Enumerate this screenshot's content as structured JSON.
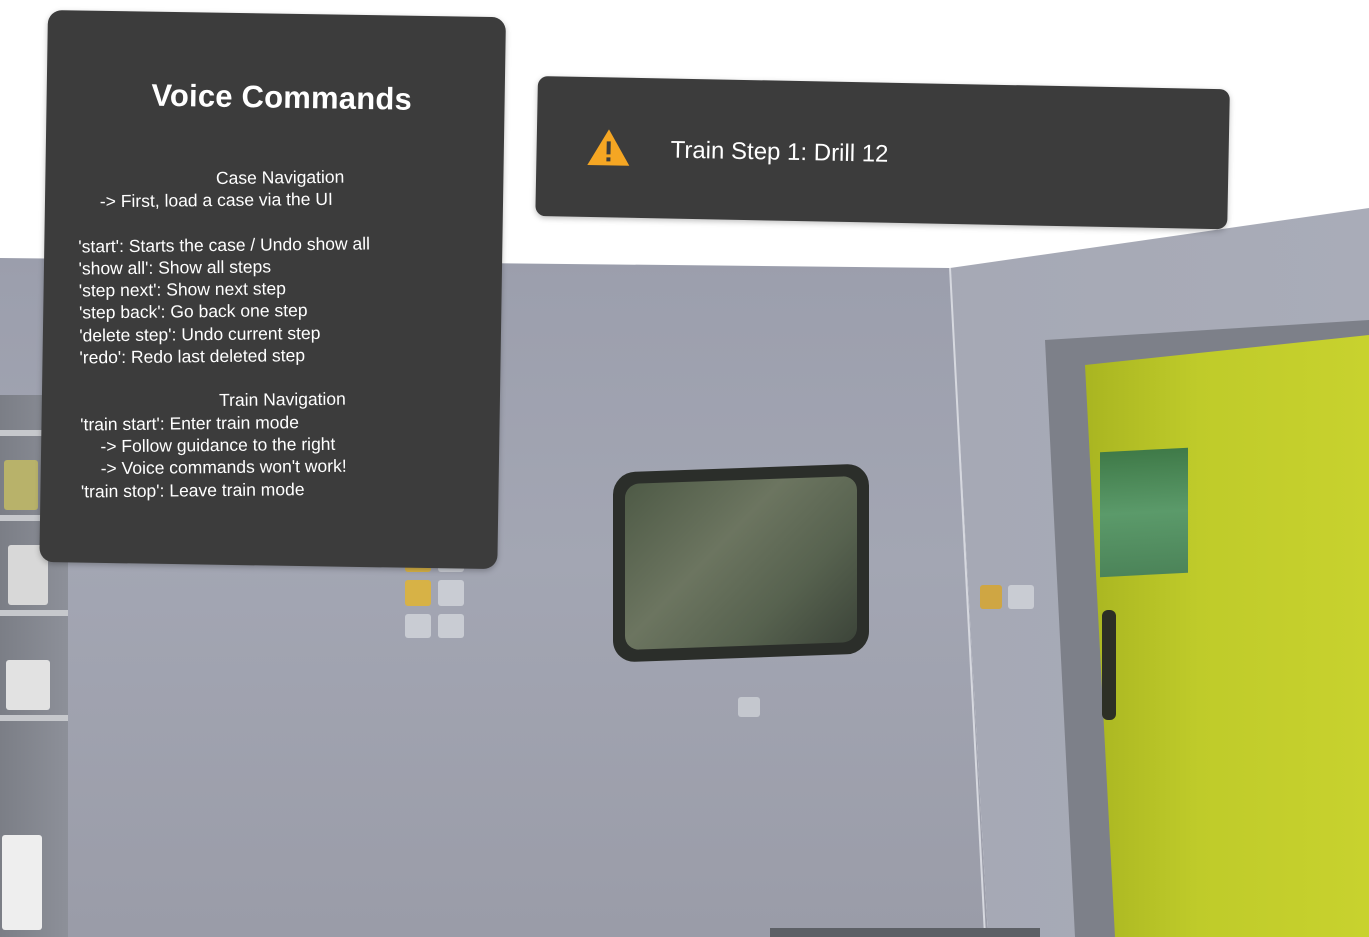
{
  "voice_commands": {
    "title": "Voice Commands",
    "case_section": {
      "heading": "Case Navigation",
      "hint": "-> First, load a case via the UI",
      "commands": [
        "'start': Starts the case / Undo show all",
        "'show all': Show all steps",
        "'step next': Show next step",
        "'step back': Go back one step",
        "'delete step': Undo current step",
        "'redo': Redo last deleted step"
      ]
    },
    "train_section": {
      "heading": "Train Navigation",
      "start_command": "'train start': Enter train mode",
      "notes": [
        "-> Follow guidance to the right",
        "-> Voice commands won't work!"
      ],
      "stop_command": "'train stop': Leave train mode"
    }
  },
  "train_step": {
    "icon": "warning-icon",
    "icon_color": "#f5a623",
    "label": "Train Step 1: Drill 12"
  },
  "colors": {
    "panel_background": "#3c3c3c",
    "panel_text": "#ffffff",
    "warning": "#f5a623"
  }
}
